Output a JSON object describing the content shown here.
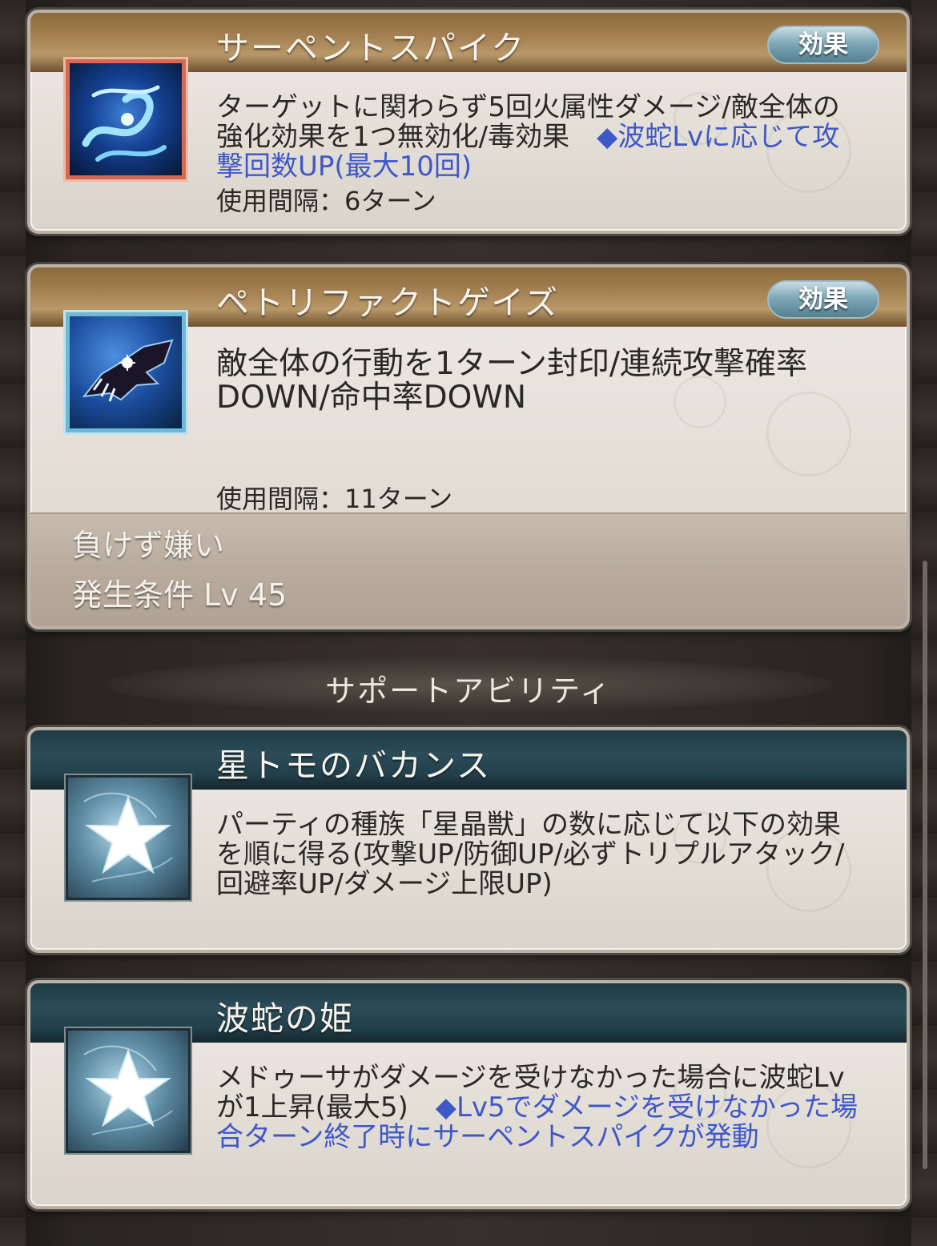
{
  "abilities": [
    {
      "title": "サーペントスパイク",
      "effect_label": "効果",
      "icon": "serpent-spike-icon",
      "desc_main": "ターゲットに関わらず5回火属性ダメージ/敵全体の強化効果を1つ無効化/毒効果　",
      "desc_note": "◆波蛇Lvに応じて攻撃回数UP(最大10回)",
      "interval": "使用間隔：6ターン"
    },
    {
      "title": "ペトリファクトゲイズ",
      "effect_label": "効果",
      "icon": "petrifact-gaze-icon",
      "desc_main": "敵全体の行動を1ターン封印/連続攻撃確率DOWN/命中率DOWN",
      "interval": "使用間隔：11ターン",
      "locked_name": "負けず嫌い",
      "locked_condition": "発生条件 Lv 45"
    }
  ],
  "support_section_title": "サポートアビリティ",
  "supports": [
    {
      "title": "星トモのバカンス",
      "icon": "star-icon",
      "desc_main": "パーティの種族「星晶獣」の数に応じて以下の効果を順に得る(攻撃UP/防御UP/必ずトリプルアタック/回避率UP/ダメージ上限UP)"
    },
    {
      "title": "波蛇の姫",
      "icon": "star-icon",
      "desc_main": "メドゥーサがダメージを受けなかった場合に波蛇Lvが1上昇(最大5)　",
      "desc_note": "◆Lv5でダメージを受けなかった場合ターン終了時にサーペントスパイクが発動"
    }
  ],
  "colors": {
    "header_brown": "#a48052",
    "header_teal": "#2c4c58",
    "note_blue": "#3f58c8",
    "text_dark": "#2b2723"
  }
}
